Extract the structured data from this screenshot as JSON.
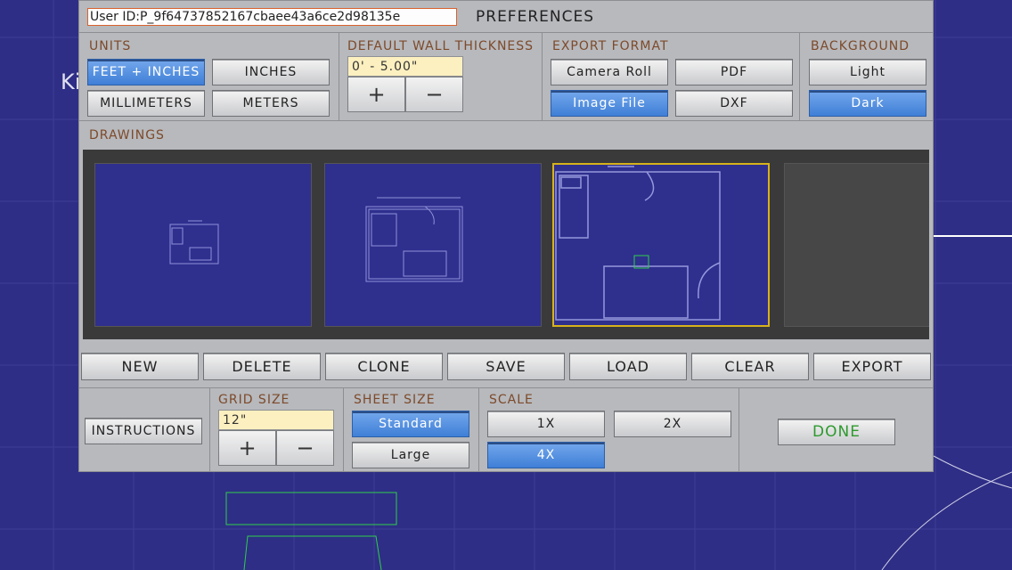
{
  "header": {
    "user_id": "User ID:P_9f64737852167cbaee43a6ce2d98135e",
    "title": "PREFERENCES"
  },
  "units": {
    "label": "UNITS",
    "options": [
      "FEET + INCHES",
      "INCHES",
      "MILLIMETERS",
      "METERS"
    ],
    "selected": "FEET + INCHES"
  },
  "wall_thickness": {
    "label": "DEFAULT WALL THICKNESS",
    "value": "0' - 5.00\"",
    "plus": "+",
    "minus": "−"
  },
  "export_format": {
    "label": "EXPORT FORMAT",
    "options": [
      "Camera Roll",
      "PDF",
      "Image File",
      "DXF"
    ],
    "selected": "Image File"
  },
  "background": {
    "label": "BACKGROUND",
    "options": [
      "Light",
      "Dark"
    ],
    "selected": "Dark"
  },
  "drawings": {
    "label": "DRAWINGS",
    "selected_index": 2
  },
  "actions": [
    "NEW",
    "DELETE",
    "CLONE",
    "SAVE",
    "LOAD",
    "CLEAR",
    "EXPORT"
  ],
  "instructions_label": "INSTRUCTIONS",
  "grid_size": {
    "label": "GRID SIZE",
    "value": "12\"",
    "plus": "+",
    "minus": "−"
  },
  "sheet_size": {
    "label": "SHEET SIZE",
    "options": [
      "Standard",
      "Large"
    ],
    "selected": "Standard"
  },
  "scale": {
    "label": "SCALE",
    "options": [
      "1X",
      "2X",
      "4X"
    ],
    "selected": "4X"
  },
  "done_label": "DONE",
  "background_text": "Ki",
  "colors": {
    "panel": "#b7b9bd",
    "selected_button": "#4a88dc",
    "field": "#fdf0c0",
    "header_text": "#7d4a2a",
    "done_text": "#2e9a2e",
    "canvas": "#2e2e86",
    "active_thumb_border": "#d6b21c"
  }
}
